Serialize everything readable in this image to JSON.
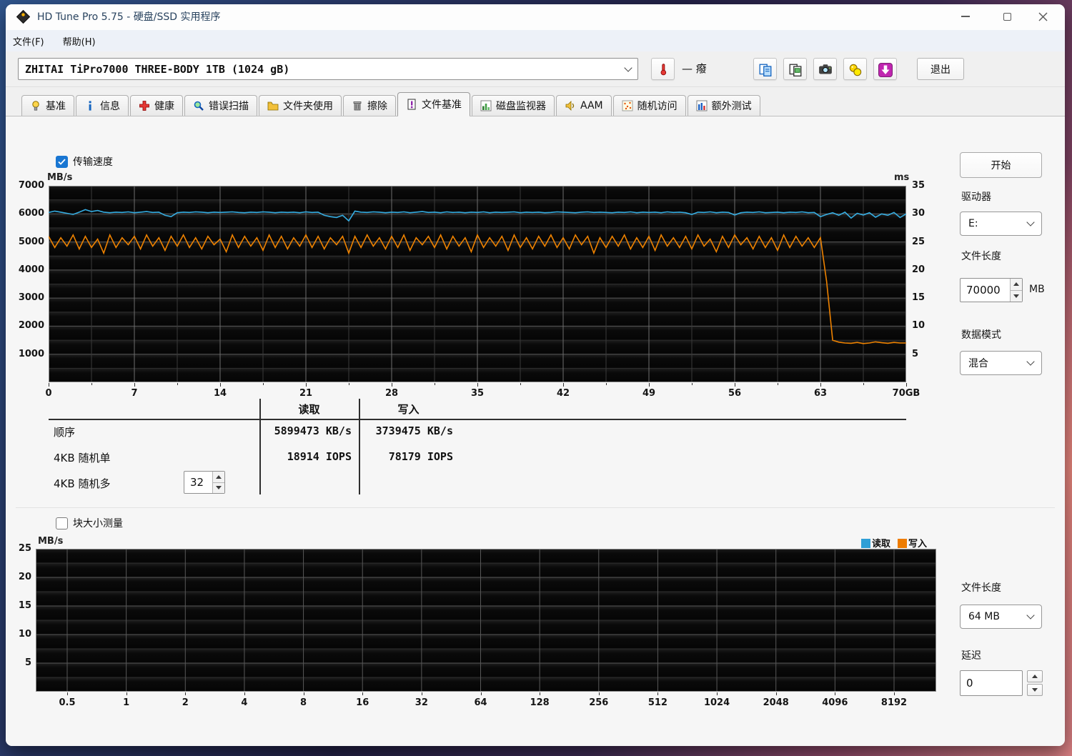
{
  "window": {
    "title": "HD Tune Pro 5.75 - 硬盘/SSD 实用程序",
    "controls": [
      "minimize",
      "maximize",
      "close"
    ]
  },
  "menu": {
    "items": [
      "文件(F)",
      "帮助(H)"
    ]
  },
  "toolbar": {
    "drive_select": "ZHITAI TiPro7000 THREE-BODY 1TB (1024 gB)",
    "temperature_display": "— 癈",
    "buttons": [
      {
        "name": "copy-text",
        "icon": "copy"
      },
      {
        "name": "copy-image",
        "icon": "copyimg"
      },
      {
        "name": "screenshot",
        "icon": "camera"
      },
      {
        "name": "options",
        "icon": "options"
      },
      {
        "name": "update",
        "icon": "download"
      }
    ],
    "exit_label": "退出"
  },
  "tabs": [
    {
      "id": "benchmark",
      "label": "基准",
      "icon": "bulb",
      "active": false
    },
    {
      "id": "info",
      "label": "信息",
      "icon": "info",
      "active": false
    },
    {
      "id": "health",
      "label": "健康",
      "icon": "health",
      "active": false
    },
    {
      "id": "error-scan",
      "label": "错误扫描",
      "icon": "scan",
      "active": false
    },
    {
      "id": "folder-usage",
      "label": "文件夹使用",
      "icon": "folder",
      "active": false
    },
    {
      "id": "erase",
      "label": "擦除",
      "icon": "erase",
      "active": false
    },
    {
      "id": "file-benchmark",
      "label": "文件基准",
      "icon": "filebench",
      "active": true
    },
    {
      "id": "disk-monitor",
      "label": "磁盘监视器",
      "icon": "monitor",
      "active": false
    },
    {
      "id": "aam",
      "label": "AAM",
      "icon": "speaker",
      "active": false
    },
    {
      "id": "random-access",
      "label": "随机访问",
      "icon": "random",
      "active": false
    },
    {
      "id": "extra-tests",
      "label": "额外测试",
      "icon": "extra",
      "active": false
    }
  ],
  "benchmark": {
    "transfer_checkbox_label": "传输速度",
    "transfer_checked": true,
    "table": {
      "headers": [
        "读取",
        "写入"
      ],
      "rows": [
        {
          "label": "顺序",
          "read": "5899473 KB/s",
          "write": "3739475 KB/s"
        },
        {
          "label": "4KB 随机单",
          "read": "18914 IOPS",
          "write": "78179 IOPS"
        },
        {
          "label": "4KB 随机多",
          "read": "",
          "write": "",
          "spinner": "32"
        }
      ]
    }
  },
  "block_test": {
    "checkbox_label": "块大小测量",
    "checked": false,
    "legend": [
      {
        "label": "读取",
        "color": "#2F9FD6"
      },
      {
        "label": "写入",
        "color": "#EE7C00"
      }
    ]
  },
  "side_panel": {
    "start_label": "开始",
    "drive_label": "驱动器",
    "drive_value": "E:",
    "file_length_label": "文件长度",
    "file_length_value": "70000",
    "file_length_unit": "MB",
    "data_mode_label": "数据模式",
    "data_mode_value": "混合"
  },
  "side_panel_bottom": {
    "file_length_label": "文件长度",
    "file_length_value": "64 MB",
    "delay_label": "延迟",
    "delay_value": "0"
  },
  "chart_data": [
    {
      "type": "line",
      "title": "传输速度",
      "ylabel": "MB/s",
      "y2label": "ms",
      "x_ticks": [
        "0",
        "7",
        "14",
        "21",
        "28",
        "35",
        "42",
        "49",
        "56",
        "63",
        "70GB"
      ],
      "x_range": [
        0,
        70
      ],
      "x_major": 7,
      "x_minor": 3.5,
      "y_ticks": [
        "7000",
        "6000",
        "5000",
        "4000",
        "3000",
        "2000",
        "1000"
      ],
      "ylim": [
        0,
        7000
      ],
      "y_major": 1000,
      "y_minor": 500,
      "y2_ticks": [
        "35",
        "30",
        "25",
        "20",
        "15",
        "10",
        "5"
      ],
      "y2lim": [
        0,
        35
      ],
      "grid": true,
      "legend_position": "none",
      "series": [
        {
          "name": "写入",
          "color": "#EE8200",
          "x0": 0,
          "dx": 0.5,
          "values": [
            5200,
            4800,
            5150,
            4850,
            5250,
            4750,
            5200,
            4800,
            5100,
            4600,
            5250,
            4800,
            5150,
            4900,
            5200,
            4750,
            5250,
            4850,
            5150,
            4700,
            5200,
            4850,
            5250,
            4800,
            5150,
            4750,
            5200,
            4900,
            5100,
            4650,
            5250,
            4800,
            5200,
            4850,
            5150,
            4700,
            5250,
            4800,
            5200,
            4750,
            5150,
            4850,
            5250,
            4800,
            5200,
            4750,
            5150,
            4900,
            5200,
            4600,
            5200,
            4800,
            5250,
            4850,
            5150,
            4750,
            5200,
            4800,
            5250,
            4700,
            5150,
            4900,
            5200,
            4800,
            5250,
            4750,
            5200,
            4850,
            5150,
            4650,
            5250,
            4800,
            5150,
            4850,
            5200,
            4700,
            5250,
            4800,
            5150,
            4750,
            5200,
            4850,
            5250,
            4800,
            5150,
            4750,
            5250,
            4900,
            5200,
            4600,
            5150,
            4800,
            5200,
            4850,
            5250,
            4750,
            5150,
            4800,
            5200,
            4700,
            5250,
            4850,
            5150,
            4800,
            5200,
            4750,
            5250,
            4850,
            5100,
            4650,
            5200,
            4800,
            5250,
            4900,
            5150,
            4750,
            5200,
            4800,
            5150,
            4700,
            5250,
            4800,
            5200,
            4850,
            5150,
            4800,
            5150,
            3600,
            1500,
            1430,
            1400,
            1390,
            1420,
            1380,
            1400,
            1440,
            1410,
            1390,
            1420,
            1400,
            1400
          ]
        },
        {
          "name": "读取",
          "color": "#35ADE2",
          "x0": 0,
          "dx": 0.5,
          "values": [
            6050,
            6100,
            6060,
            6020,
            5980,
            6060,
            6150,
            6080,
            6120,
            6060,
            6040,
            6060,
            6050,
            6070,
            6040,
            6060,
            6080,
            6050,
            6060,
            5950,
            5900,
            6040,
            6060,
            6050,
            6070,
            6060,
            6040,
            6060,
            6050,
            6060,
            6070,
            6050,
            6040,
            6060,
            6050,
            6070,
            6060,
            6040,
            6060,
            6050,
            6060,
            6040,
            6070,
            6050,
            6060,
            5950,
            5900,
            5870,
            5950,
            5750,
            6100,
            6060,
            6050,
            6070,
            6060,
            6040,
            6060,
            6050,
            6070,
            6040,
            6060,
            6080,
            6050,
            6060,
            6040,
            6070,
            6050,
            6060,
            6040,
            6060,
            6050,
            6070,
            6040,
            6060,
            6050,
            6060,
            6070,
            6040,
            6060,
            6050,
            6060,
            6040,
            6050,
            6070,
            6060,
            6050,
            6040,
            6060,
            6070,
            6050,
            6060,
            6050,
            6040,
            6060,
            6050,
            6070,
            6040,
            6060,
            6050,
            6060,
            6040,
            6070,
            6050,
            6060,
            6040,
            5980,
            6060,
            6050,
            6070,
            6040,
            6060,
            6050,
            5960,
            6040,
            6060,
            6050,
            6070,
            6040,
            6050,
            6060,
            6040,
            6060,
            6050,
            6070,
            6040,
            6050,
            5900,
            5980,
            6040,
            5950,
            6060,
            5850,
            6020,
            5960,
            6040,
            5880,
            6000,
            5950,
            6050,
            5870,
            6000
          ]
        }
      ]
    },
    {
      "type": "line",
      "title": "块大小测量",
      "ylabel": "MB/s",
      "x_ticks": [
        "0.5",
        "1",
        "2",
        "4",
        "8",
        "16",
        "32",
        "64",
        "128",
        "256",
        "512",
        "1024",
        "2048",
        "4096",
        "8192"
      ],
      "y_ticks": [
        "25",
        "20",
        "15",
        "10",
        "5"
      ],
      "ylim": [
        0,
        25
      ],
      "y_major": 5,
      "y_minor": 2.5,
      "grid": true,
      "legend_position": "top-right",
      "series": []
    }
  ]
}
